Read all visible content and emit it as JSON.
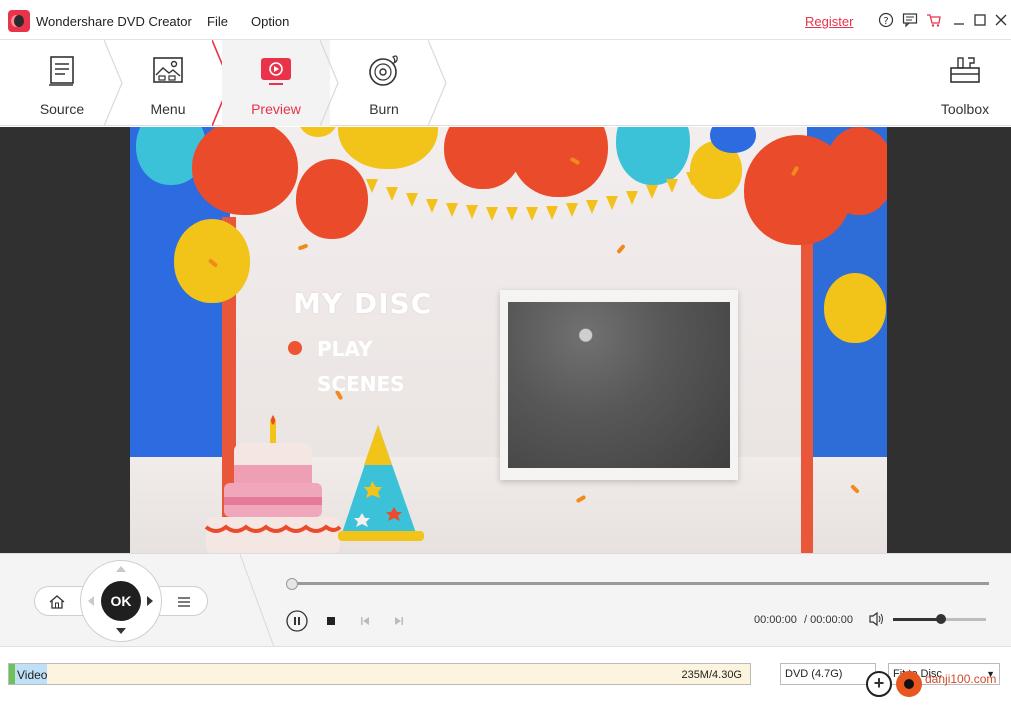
{
  "window": {
    "app_title": "Wondershare DVD Creator",
    "menu": [
      "File",
      "Option"
    ],
    "register_label": "Register",
    "icons": [
      "help-icon",
      "feedback-icon",
      "cart-icon",
      "minimize-icon",
      "maximize-icon",
      "close-icon"
    ]
  },
  "steps": [
    {
      "label": "Source",
      "icon": "source-icon",
      "active": false
    },
    {
      "label": "Menu",
      "icon": "menu-template-icon",
      "active": false
    },
    {
      "label": "Preview",
      "icon": "preview-icon",
      "active": true
    },
    {
      "label": "Burn",
      "icon": "burn-disc-icon",
      "active": false
    }
  ],
  "toolbox": {
    "label": "Toolbox",
    "icon": "toolbox-icon"
  },
  "preview_menu": {
    "title": "MY DISC",
    "options": [
      "PLAY",
      "SCENES"
    ]
  },
  "remote": {
    "ok_label": "OK"
  },
  "player": {
    "current_time": "00:00:00",
    "total_time": "/ 00:00:00",
    "progress": 0,
    "volume": 0.5
  },
  "status": {
    "capacity_label": "Video",
    "capacity_size": "235M/4.30G",
    "disc_type": "DVD (4.7G)",
    "fit_mode": "Fit to Disc"
  },
  "watermark": "danji100.com",
  "colors": {
    "accent": "#e8334a"
  }
}
